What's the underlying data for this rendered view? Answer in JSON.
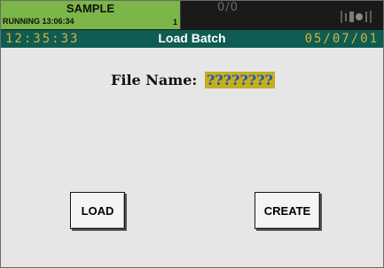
{
  "status_bar": {
    "batch_name": "SAMPLE",
    "batch_state": "RUNNING",
    "batch_time": "13:06:34",
    "batch_count": "1",
    "alarm_count": "0/0",
    "icon": "signal-icon"
  },
  "title_bar": {
    "time": "12:35:33",
    "title": "Load Batch",
    "date": "05/07/01"
  },
  "form": {
    "file_name_label": "File Name:",
    "file_name_value": "????????"
  },
  "buttons": {
    "load": "LOAD",
    "create": "CREATE"
  },
  "colors": {
    "batch_status_bg": "#7ab648",
    "title_bar_bg": "#0e5c52",
    "clock_text": "#d8b13a",
    "field_highlight": "#c6ad24",
    "content_bg": "#e6e6e6"
  }
}
